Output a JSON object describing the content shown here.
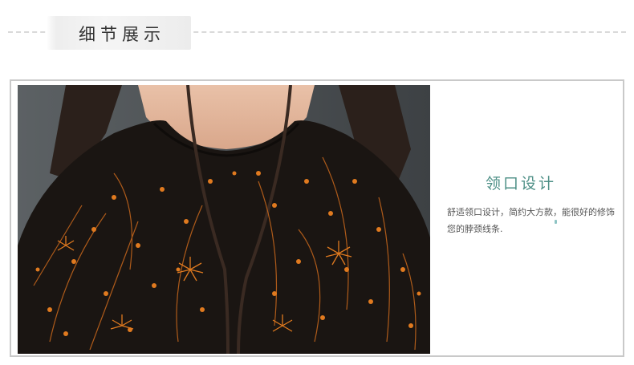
{
  "header": {
    "title": "细节展示"
  },
  "photo": {
    "subject": "model-neckline-floral-dress"
  },
  "feature": {
    "title": "领口设计",
    "description": "舒适领口设计，简约大方款，能很好的修饰您的脖颈线条."
  },
  "colors": {
    "accent": "#4d8f86",
    "fabric": "#1a1512",
    "print": "#e07a1f"
  }
}
